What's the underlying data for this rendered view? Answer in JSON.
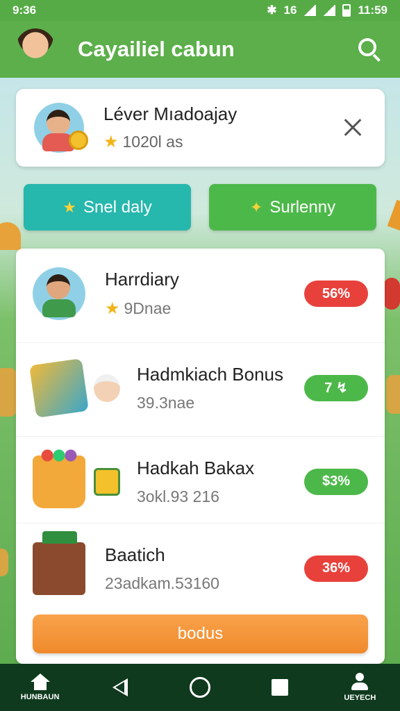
{
  "status_bar": {
    "time": "9:36",
    "right_time": "11:59",
    "indicator": "16"
  },
  "header": {
    "title": "Cayailiel cabun"
  },
  "profile": {
    "name": "Léver Mıadoajay",
    "stat": "1020l as"
  },
  "actions": [
    {
      "label": "Snel daly",
      "icon": "star-icon"
    },
    {
      "label": "Surlenny",
      "icon": "sparkle-icon"
    }
  ],
  "list": [
    {
      "title": "Harrdiary",
      "sub": "9Dnae",
      "badge": "56%",
      "badge_color": "#e8413c",
      "has_star": true
    },
    {
      "title": "Hadmkiach Bonus",
      "sub": "39.3nae",
      "badge": "7 ↯",
      "badge_color": "#4db84a",
      "has_star": false
    },
    {
      "title": "Hadkah Bakax",
      "sub": "3okl.93 216",
      "badge": "$3%",
      "badge_color": "#4db84a",
      "has_star": false
    },
    {
      "title": "Baatich",
      "sub": "23adkam.53160",
      "badge": "36%",
      "badge_color": "#e8413c",
      "has_star": false
    }
  ],
  "bonus_button": "bodus",
  "nav": {
    "left_label": "HUNBAUN",
    "right_label": "UEYECH"
  },
  "colors": {
    "primary_green": "#5caf4a",
    "teal": "#26b7ad",
    "orange": "#f08a2c",
    "red": "#e8413c",
    "nav_bg": "#0f3a1e"
  }
}
